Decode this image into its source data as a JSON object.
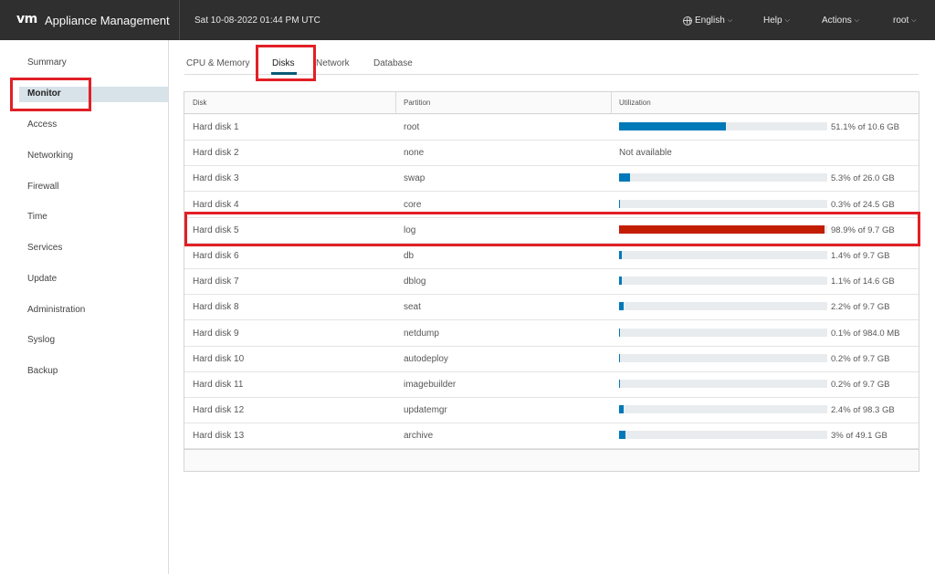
{
  "header": {
    "logo": "vm",
    "title": "Appliance Management",
    "datetime": "Sat 10-08-2022 01:44 PM UTC",
    "nav": [
      {
        "label": "English",
        "icon": "globe-icon"
      },
      {
        "label": "Help"
      },
      {
        "label": "Actions"
      },
      {
        "label": "root"
      }
    ]
  },
  "sidebar": {
    "items": [
      {
        "label": "Summary"
      },
      {
        "label": "Monitor",
        "active": true
      },
      {
        "label": "Access"
      },
      {
        "label": "Networking"
      },
      {
        "label": "Firewall"
      },
      {
        "label": "Time"
      },
      {
        "label": "Services"
      },
      {
        "label": "Update"
      },
      {
        "label": "Administration"
      },
      {
        "label": "Syslog"
      },
      {
        "label": "Backup"
      }
    ]
  },
  "tabs": [
    {
      "label": "CPU & Memory"
    },
    {
      "label": "Disks",
      "active": true
    },
    {
      "label": "Network"
    },
    {
      "label": "Database"
    }
  ],
  "table": {
    "columns": [
      "Disk",
      "Partition",
      "Utilization"
    ],
    "rows": [
      {
        "disk": "Hard disk 1",
        "partition": "root",
        "util_pct": 51.1,
        "util_text": "51.1% of 10.6 GB"
      },
      {
        "disk": "Hard disk 2",
        "partition": "none",
        "util_pct": null,
        "util_text": "Not available"
      },
      {
        "disk": "Hard disk 3",
        "partition": "swap",
        "util_pct": 5.3,
        "util_text": "5.3% of 26.0 GB"
      },
      {
        "disk": "Hard disk 4",
        "partition": "core",
        "util_pct": 0.3,
        "util_text": "0.3% of 24.5 GB"
      },
      {
        "disk": "Hard disk 5",
        "partition": "log",
        "util_pct": 98.9,
        "util_text": "98.9% of 9.7 GB",
        "critical": true
      },
      {
        "disk": "Hard disk 6",
        "partition": "db",
        "util_pct": 1.4,
        "util_text": "1.4% of 9.7 GB"
      },
      {
        "disk": "Hard disk 7",
        "partition": "dblog",
        "util_pct": 1.1,
        "util_text": "1.1% of 14.6 GB"
      },
      {
        "disk": "Hard disk 8",
        "partition": "seat",
        "util_pct": 2.2,
        "util_text": "2.2% of 9.7 GB"
      },
      {
        "disk": "Hard disk 9",
        "partition": "netdump",
        "util_pct": 0.1,
        "util_text": "0.1% of 984.0 MB"
      },
      {
        "disk": "Hard disk 10",
        "partition": "autodeploy",
        "util_pct": 0.2,
        "util_text": "0.2% of 9.7 GB"
      },
      {
        "disk": "Hard disk 11",
        "partition": "imagebuilder",
        "util_pct": 0.2,
        "util_text": "0.2% of 9.7 GB"
      },
      {
        "disk": "Hard disk 12",
        "partition": "updatemgr",
        "util_pct": 2.4,
        "util_text": "2.4% of 98.3 GB"
      },
      {
        "disk": "Hard disk 13",
        "partition": "archive",
        "util_pct": 3,
        "util_text": "3% of 49.1 GB"
      }
    ]
  },
  "colors": {
    "header_bg": "#2f2f2f",
    "bar_normal": "#0079b8",
    "bar_critical": "#c21d00",
    "annotation": "#e21f26"
  }
}
